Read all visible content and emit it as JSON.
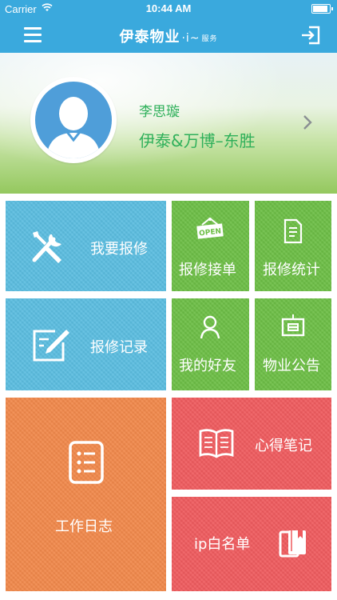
{
  "status_bar": {
    "carrier": "Carrier",
    "time": "10:44 AM"
  },
  "nav": {
    "logo_text": "伊泰物业",
    "logo_mark": "·i~",
    "logo_sub": "服务",
    "menu_icon": "hamburger-menu-icon",
    "logout_icon": "logout-icon"
  },
  "profile": {
    "name": "李思璇",
    "org": "伊泰&万博–东胜"
  },
  "colors": {
    "header": "#3aa9dd",
    "blue_tile": "#5bbde0",
    "green_tile": "#6cbe45",
    "orange_tile": "#f1884a",
    "red_tile": "#ef5b5e",
    "profile_text": "#2fb05a"
  },
  "tiles": {
    "repair_request": {
      "label": "我要报修",
      "icon": "tools-icon"
    },
    "repair_orders": {
      "label": "报修接单",
      "icon": "open-sign-icon",
      "icon_text": "OPEN"
    },
    "repair_stats": {
      "label": "报修统计",
      "icon": "document-icon"
    },
    "repair_records": {
      "label": "报修记录",
      "icon": "edit-icon"
    },
    "my_friends": {
      "label": "我的好友",
      "icon": "person-icon"
    },
    "property_notice": {
      "label": "物业公告",
      "icon": "notice-board-icon"
    },
    "work_log": {
      "label": "工作日志",
      "icon": "list-icon"
    },
    "notes": {
      "label": "心得笔记",
      "icon": "book-icon"
    },
    "ip_whitelist": {
      "label": "ip白名单",
      "icon": "books-icon"
    }
  }
}
